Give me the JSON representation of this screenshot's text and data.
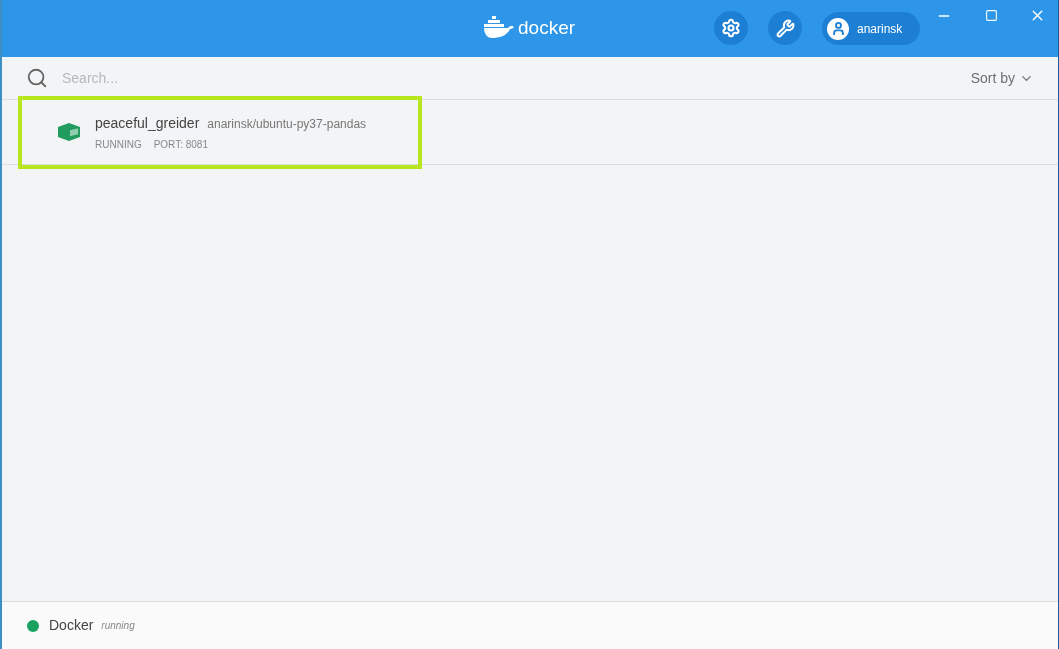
{
  "header": {
    "logo_text": "docker",
    "user": "anarinsk"
  },
  "toolbar": {
    "search": {
      "placeholder": "Search..."
    },
    "sort_label": "Sort by"
  },
  "containers": [
    {
      "name": "peaceful_greider",
      "image": "anarinsk/ubuntu-py37-pandas",
      "status": "RUNNING",
      "port": "PORT: 8081",
      "highlighted": true
    }
  ],
  "status_bar": {
    "name": "Docker",
    "state": "running",
    "color": "#1aa260"
  }
}
